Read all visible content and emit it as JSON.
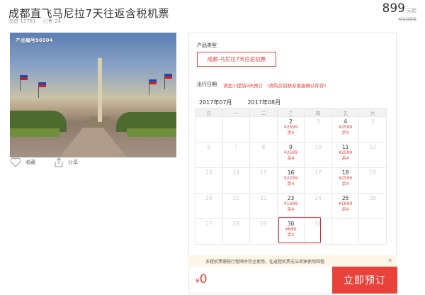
{
  "header": {
    "title": "成都直飞马尼拉7天往返含税机票",
    "views_label": "浏览 13781",
    "sold_label": "已售 24",
    "price": "899",
    "price_suffix": "元起",
    "original_price": "¥1999"
  },
  "gallery": {
    "product_code": "产品编号96904"
  },
  "actions": {
    "favorite": "收藏",
    "share": "分享"
  },
  "booking": {
    "product_type_label": "产品类型",
    "product_type_value": "成都-马尼拉7天往返机票",
    "date_label": "出行日期",
    "advance_note": "请至少提前9天预订",
    "contact_note": "(请购买前联系客服确认库存)",
    "months": [
      "2017年07月",
      "2017年08月"
    ],
    "active_month_index": 1,
    "weekdays": [
      "日",
      "一",
      "二",
      "三",
      "四",
      "五",
      "六"
    ],
    "weeks": [
      [
        {
          "d": ""
        },
        {
          "d": ""
        },
        {
          "d": ""
        },
        {
          "d": "2",
          "p": "¥2599",
          "r": "余4"
        },
        {
          "d": "3"
        },
        {
          "d": "4",
          "p": "¥2599",
          "r": "余4"
        },
        {
          "d": "5"
        }
      ],
      [
        {
          "d": "6"
        },
        {
          "d": "7"
        },
        {
          "d": "8"
        },
        {
          "d": "9",
          "p": "¥2599",
          "r": "余4"
        },
        {
          "d": "10"
        },
        {
          "d": "11",
          "p": "¥2599",
          "r": "余4"
        },
        {
          "d": "12"
        }
      ],
      [
        {
          "d": "13"
        },
        {
          "d": "14"
        },
        {
          "d": "15"
        },
        {
          "d": "16",
          "p": "¥2299",
          "r": "余4"
        },
        {
          "d": "17"
        },
        {
          "d": "18",
          "p": "¥2599",
          "r": "余4"
        },
        {
          "d": "19"
        }
      ],
      [
        {
          "d": "20"
        },
        {
          "d": "21"
        },
        {
          "d": "22"
        },
        {
          "d": "23",
          "p": "¥1699",
          "r": "余4"
        },
        {
          "d": "24"
        },
        {
          "d": "25",
          "p": "¥1699",
          "r": "余4"
        },
        {
          "d": "26"
        }
      ],
      [
        {
          "d": "27"
        },
        {
          "d": "28"
        },
        {
          "d": "29"
        },
        {
          "d": "30",
          "p": "¥899",
          "r": "余4",
          "selected": true
        },
        {
          "d": "31"
        },
        {
          "d": ""
        },
        {
          "d": ""
        }
      ]
    ],
    "notice": "多程机票需按行程顺序完全使用，往返程机票无法单独使用回程",
    "total_currency": "¥",
    "total_value": "0",
    "book_button": "立即预订"
  },
  "colors": {
    "accent": "#e2443b",
    "button": "#e8423b"
  }
}
